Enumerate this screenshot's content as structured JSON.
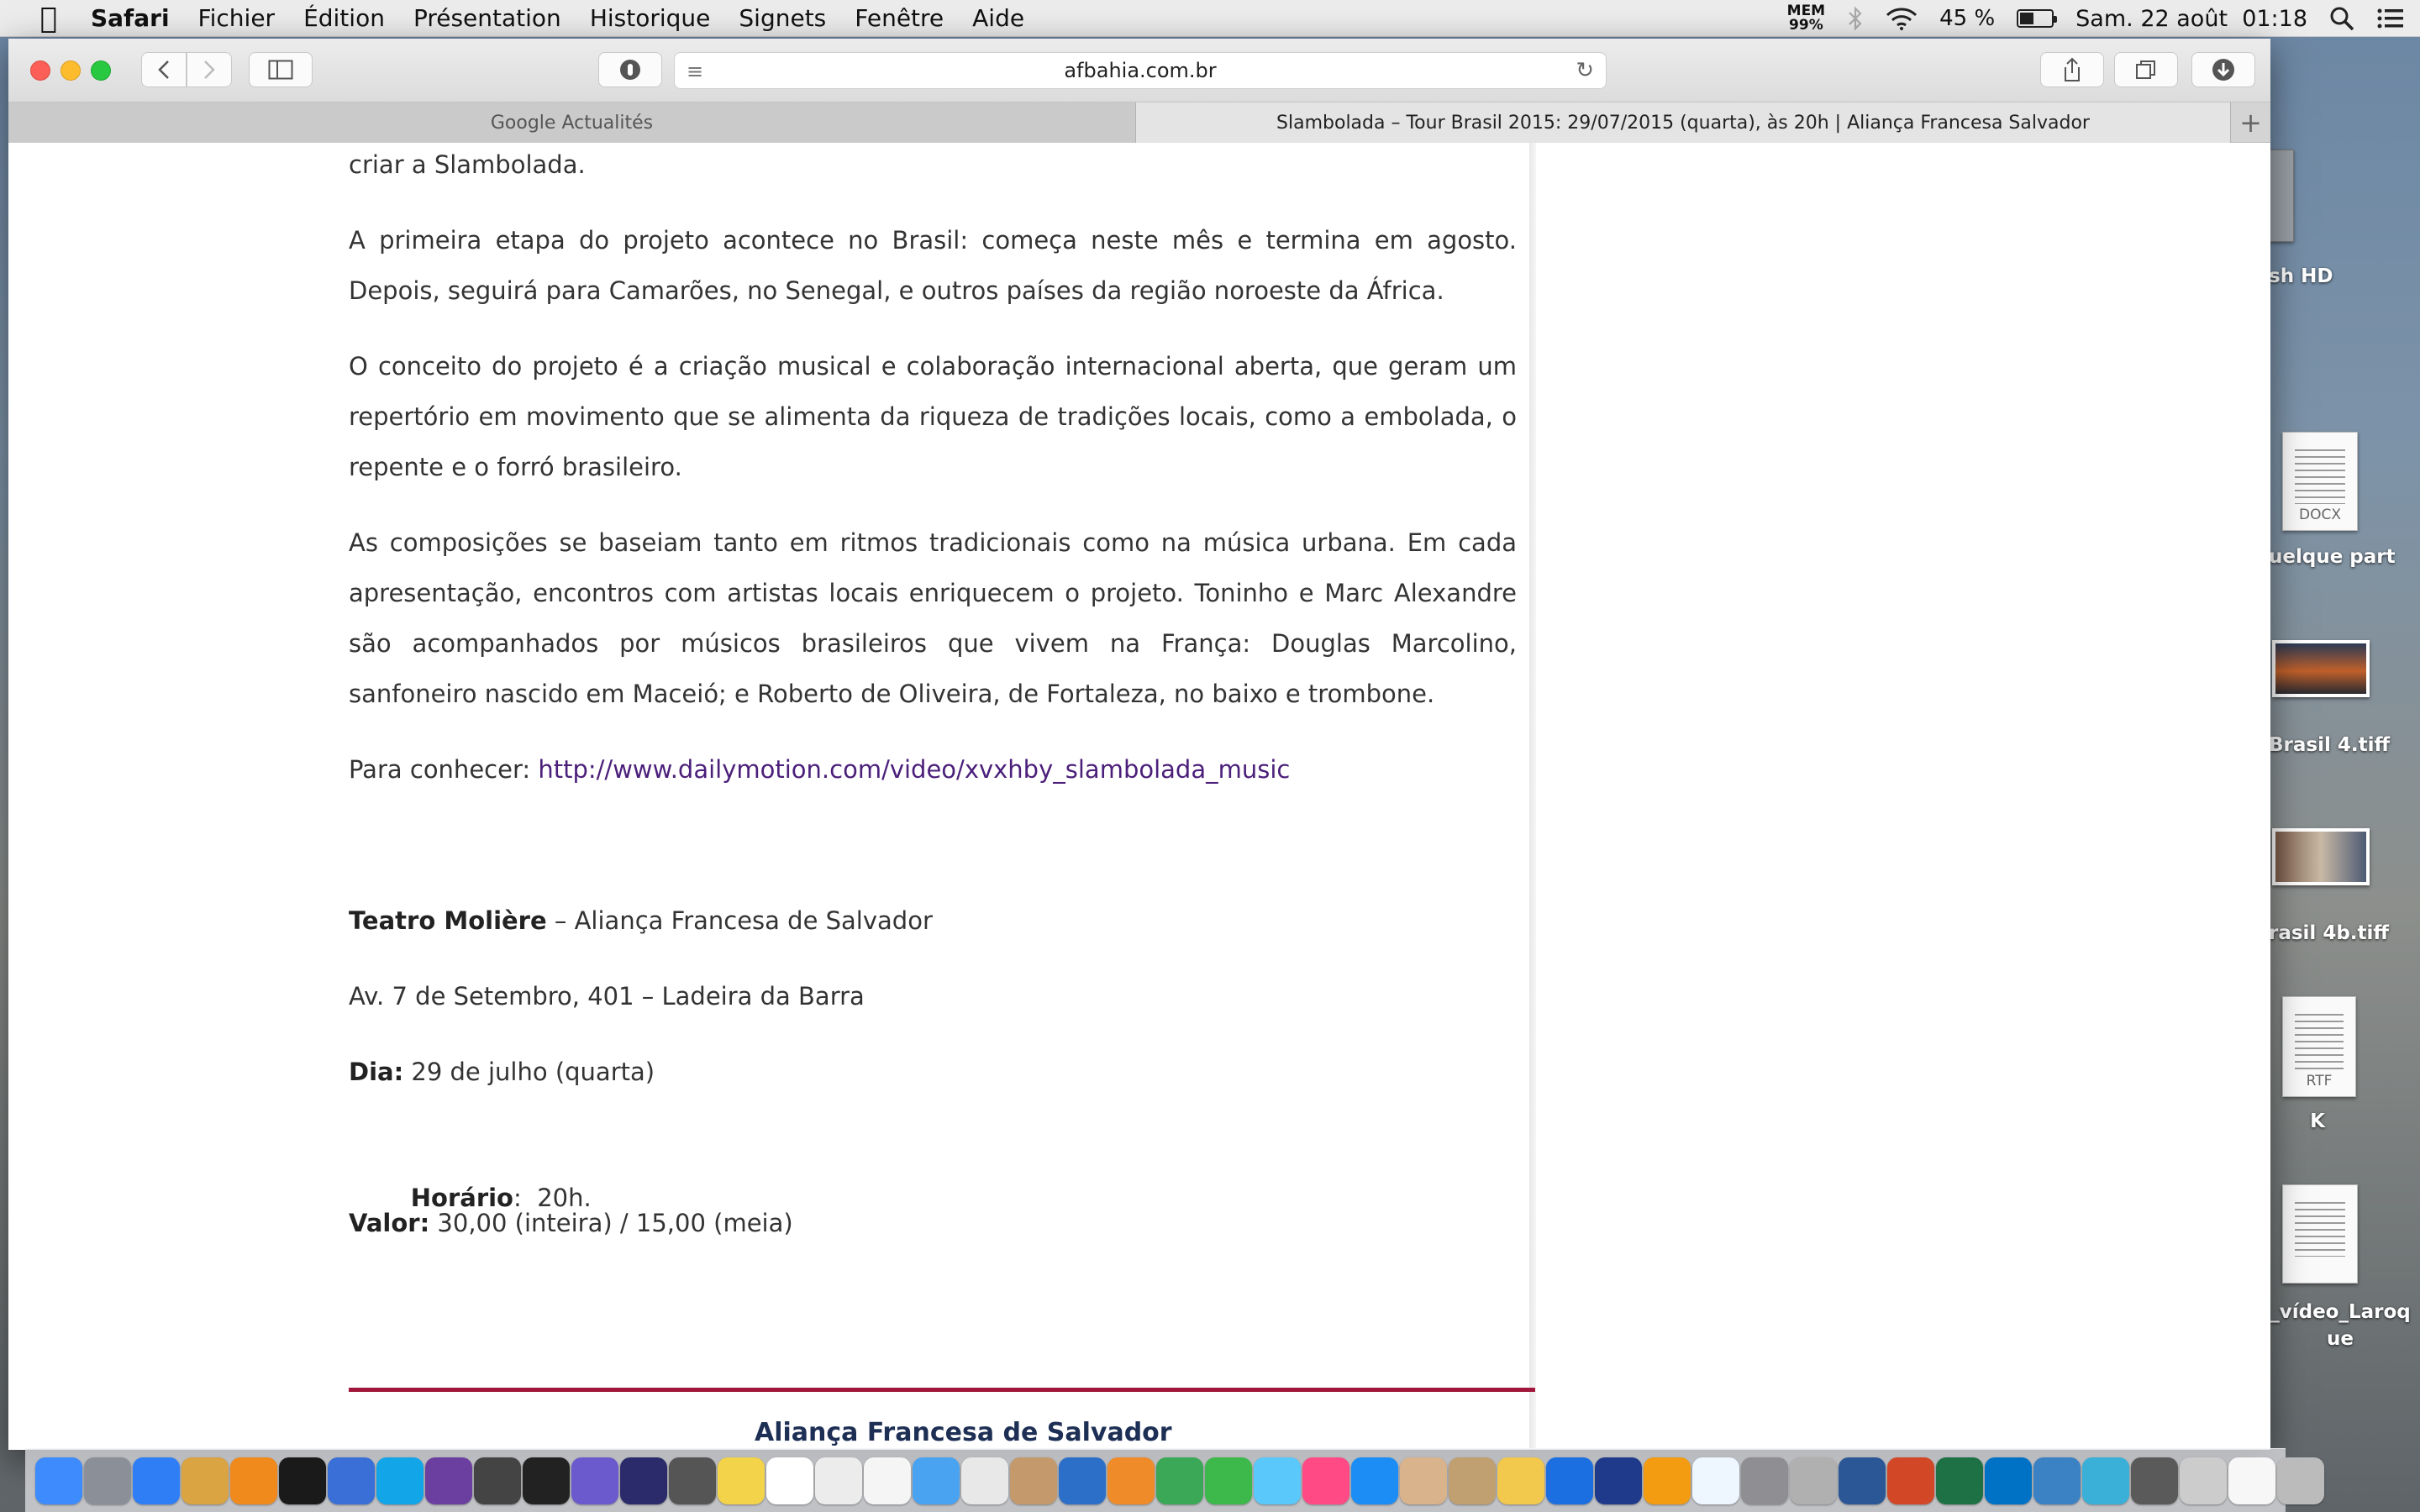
{
  "menubar": {
    "apple_icon": "apple-icon",
    "app_name": "Safari",
    "items": [
      "Fichier",
      "Édition",
      "Présentation",
      "Historique",
      "Signets",
      "Fenêtre",
      "Aide"
    ],
    "mem_label": "MEM",
    "mem_value": "99%",
    "battery_percent": "45 %",
    "battery_level": 45,
    "datetime": "Sam. 22 août  01:18"
  },
  "desktop": {
    "items": [
      {
        "label": "sh HD"
      },
      {
        "label": "uelque part",
        "ext": "DOCX"
      },
      {
        "label": "Brasil 4.tiff"
      },
      {
        "label": "rasil 4b.tiff"
      },
      {
        "label": "K",
        "ext": "RTF"
      },
      {
        "label": "_vídeo_Laroq ue"
      }
    ]
  },
  "browser": {
    "url": "afbahia.com.br",
    "tabs": [
      {
        "label": "Google Actualités"
      },
      {
        "label": "Slambolada – Tour Brasil 2015: 29/07/2015 (quarta), às 20h | Aliança Francesa Salvador"
      }
    ],
    "new_tab": "+"
  },
  "article": {
    "p0": "criar a Slambolada.",
    "p1": "A primeira etapa do projeto acontece no Brasil: começa neste mês e termina em agosto. Depois, seguirá para Camarões, no Senegal, e outros países da região noroeste da África.",
    "p2": "O conceito do projeto é a criação musical e colaboração internacional aberta, que geram um repertório em movimento que se alimenta da riqueza de tradições locais, como a embolada, o repente e o forró brasileiro.",
    "p3": "As composições se baseiam tanto em ritmos tradicionais como na música urbana. Em cada apresentação, encontros com artistas locais enriquecem o projeto. Toninho e Marc Alexandre são acompanhados por músicos brasileiros que vivem na França: Douglas Marcolino, sanfoneiro nascido em Maceió; e Roberto de Oliveira, de Fortaleza, no baixo e trombone.",
    "link_prefix": "Para conhecer: ",
    "link": "http://www.dailymotion.com/video/xvxhby_slambolada_music",
    "venue_bold": "Teatro Molière",
    "venue_rest": " – Aliança Francesa de Salvador",
    "address": "Av. 7 de Setembro, 401 – Ladeira da Barra",
    "dia_label": "Dia:",
    "dia_value": " 29 de julho (quarta)",
    "horario_label": "Horário",
    "horario_value": ":  20h.",
    "valor_label": "Valor:",
    "valor_value": " 30,00 (inteira) / 15,00 (meia)",
    "footer_title": "Aliança Francesa de Salvador"
  },
  "colors": {
    "link": "#4b1f7a",
    "divider": "#a0173b",
    "footer_title": "#1e2f55"
  },
  "dock": {
    "apps": [
      "finder-icon",
      "launchpad-icon",
      "safari-icon",
      "preview-icon",
      "vlc-icon",
      "quicktime-icon",
      "screen-sharing-icon",
      "skype-icon",
      "imovie-icon",
      "final-cut-icon",
      "procut-icon",
      "app-icon",
      "dvd-icon",
      "camera-icon",
      "notes-icon",
      "calendar-icon",
      "textedit-icon",
      "reminders-icon",
      "mail-icon",
      "photos-icon",
      "contacts-icon",
      "keynote-icon",
      "pages-icon",
      "numbers-icon",
      "facetime-icon",
      "messages-icon",
      "itunes-icon",
      "app-store-icon",
      "paintbrush-icon",
      "pencil-icon",
      "archive-icon",
      "shazam-icon",
      "hotspot-icon",
      "books-icon",
      "weather-icon",
      "system-prefs-icon",
      "brush-icon",
      "word-icon",
      "powerpoint-icon",
      "excel-icon",
      "outlook-icon",
      "chrome-icon",
      "windows-icon",
      "language-icon",
      "disk-icon",
      "document-icon",
      "trash-icon"
    ]
  }
}
